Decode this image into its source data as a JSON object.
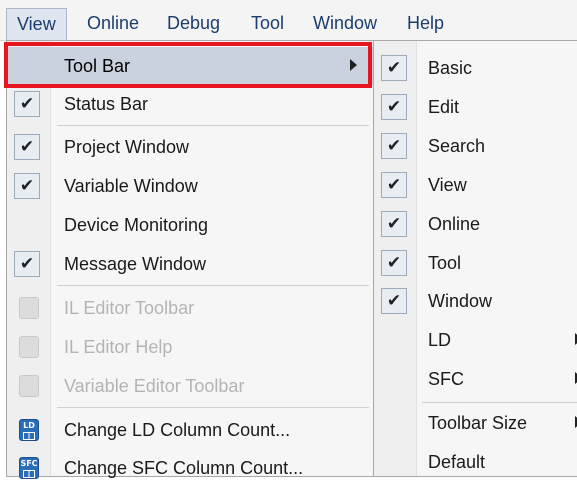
{
  "menubar": {
    "items": [
      "View",
      "Online",
      "Debug",
      "Tool",
      "Window",
      "Help"
    ]
  },
  "view_menu": {
    "items": [
      {
        "label": "Tool Bar",
        "checked": false,
        "submenu": true,
        "highlighted": true,
        "enabled": true
      },
      {
        "label": "Status Bar",
        "checked": true,
        "enabled": true
      },
      {
        "label": "Project Window",
        "checked": true,
        "enabled": true
      },
      {
        "label": "Variable Window",
        "checked": true,
        "enabled": true
      },
      {
        "label": "Device Monitoring",
        "checked": false,
        "enabled": true
      },
      {
        "label": "Message Window",
        "checked": true,
        "enabled": true
      },
      {
        "label": "IL Editor Toolbar",
        "checked": false,
        "enabled": false,
        "icon": "il-editor-toolbar-icon"
      },
      {
        "label": "IL Editor Help",
        "checked": false,
        "enabled": false,
        "icon": "il-editor-help-icon"
      },
      {
        "label": "Variable Editor Toolbar",
        "checked": false,
        "enabled": false,
        "icon": "variable-editor-toolbar-icon"
      },
      {
        "label": "Change LD Column Count...",
        "checked": false,
        "enabled": true,
        "icon": "ld-column-icon",
        "icon_text": "LD"
      },
      {
        "label": "Change SFC Column Count...",
        "checked": false,
        "enabled": true,
        "icon": "sfc-column-icon",
        "icon_text": "SFC"
      }
    ]
  },
  "toolbar_submenu": {
    "items": [
      {
        "label": "Basic",
        "checked": true
      },
      {
        "label": "Edit",
        "checked": true
      },
      {
        "label": "Search",
        "checked": true
      },
      {
        "label": "View",
        "checked": true
      },
      {
        "label": "Online",
        "checked": true
      },
      {
        "label": "Tool",
        "checked": true
      },
      {
        "label": "Window",
        "checked": true
      },
      {
        "label": "LD",
        "checked": false,
        "submenu": true
      },
      {
        "label": "SFC",
        "checked": false,
        "submenu": true
      },
      {
        "label": "Toolbar Size",
        "checked": false,
        "submenu": true
      },
      {
        "label": "Default",
        "checked": false
      }
    ]
  },
  "check_glyph": "✔",
  "colors": {
    "highlight_frame": "#e5161f",
    "highlight_row": "#c9d2de",
    "menubar_text": "#1a3d6e",
    "disabled_text": "#b4b4b4",
    "icon_blue": "#2a6db8"
  }
}
